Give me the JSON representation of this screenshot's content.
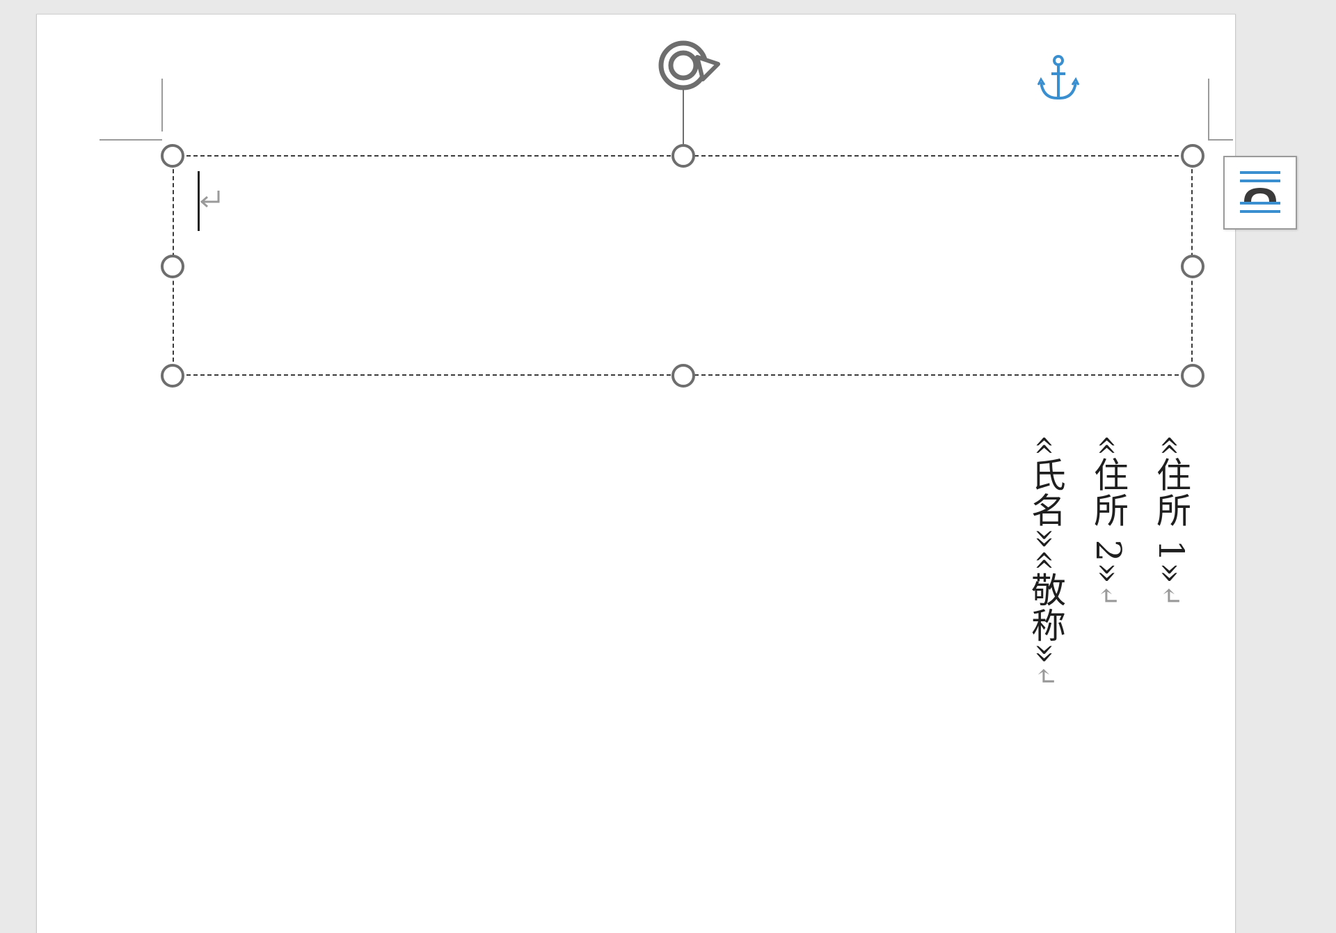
{
  "document": {
    "address_lines": [
      {
        "field": "«住所 1»",
        "paragraph_mark": "↵"
      },
      {
        "field": "«住所 2»",
        "paragraph_mark": "↵"
      },
      {
        "field": "«氏名»«敬称»",
        "paragraph_mark": "↵"
      }
    ],
    "textbox_paragraph_mark": "↵"
  },
  "icons": {
    "rotate": "rotate-icon",
    "anchor": "anchor-icon",
    "layout_options": "layout-options-icon"
  },
  "colors": {
    "anchor": "#3a8fd0",
    "layout_icon_lines": "#3a8fd0",
    "handle_stroke": "#6e6e6e",
    "page_background": "#ffffff",
    "canvas_background": "#e9e9e9"
  }
}
